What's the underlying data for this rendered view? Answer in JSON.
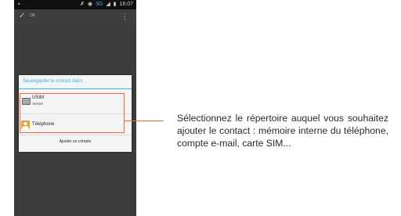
{
  "statusbar": {
    "network": "3G",
    "time": "16:07",
    "icons": [
      "notification-icon",
      "mute-icon",
      "wifi-icon",
      "signal-icon",
      "battery-icon"
    ]
  },
  "actionbar": {
    "done_label": "OK",
    "icons": [
      "check-icon",
      "overflow-menu-icon"
    ]
  },
  "dialog": {
    "title": "Sauvegarder le contact dans",
    "options": [
      {
        "label": "USIM",
        "icon": "sim-card-icon"
      },
      {
        "label": "Téléphone",
        "icon": "contact-person-icon"
      }
    ],
    "add_account": "Ajouter un compte"
  },
  "annotation": {
    "text": "Sélectionnez le répertoire auquel vous souhaitez ajouter le contact : mémoire interne du téléphone, compte e-mail, carte SIM..."
  },
  "colors": {
    "accent": "#33b5e5",
    "highlight": "#ef6a37",
    "phone_icon": "#f39a2c",
    "screen_bg": "#3c3c3c"
  }
}
